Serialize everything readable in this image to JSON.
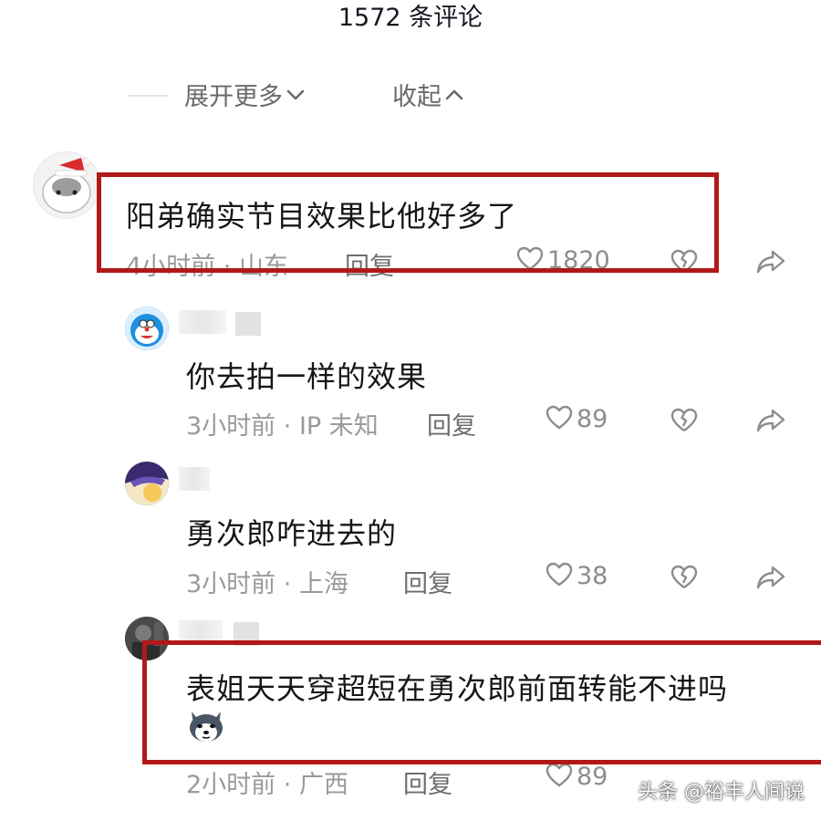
{
  "header": {
    "title": "1572 条评论"
  },
  "thread_controls": {
    "expand_label": "展开更多",
    "collapse_label": "收起"
  },
  "comments": [
    {
      "text": "阳弟确实节目效果比他好多了",
      "time": "4小时前",
      "location": "山东",
      "reply_label": "回复",
      "likes": "1820",
      "avatar": "hamster-santa-hat"
    },
    {
      "text": "你去拍一样的效果",
      "time": "3小时前",
      "location": "IP 未知",
      "reply_label": "回复",
      "likes": "89",
      "avatar": "doraemon"
    },
    {
      "text": "勇次郎咋进去的",
      "time": "3小时前",
      "location": "上海",
      "reply_label": "回复",
      "likes": "38",
      "avatar": "anime-character"
    },
    {
      "text": "表姐天天穿超短在勇次郎前面转能不进吗",
      "time": "2小时前",
      "location": "广西",
      "reply_label": "回复",
      "likes": "89",
      "avatar": "dark-photo",
      "emoji": "husky-dog-emoji"
    }
  ],
  "meta_separator": "·",
  "watermark": "头条 @裕丰人间说",
  "colors": {
    "highlight_box": "#b21818",
    "meta_text": "#9a9a9a",
    "text": "#161616"
  }
}
